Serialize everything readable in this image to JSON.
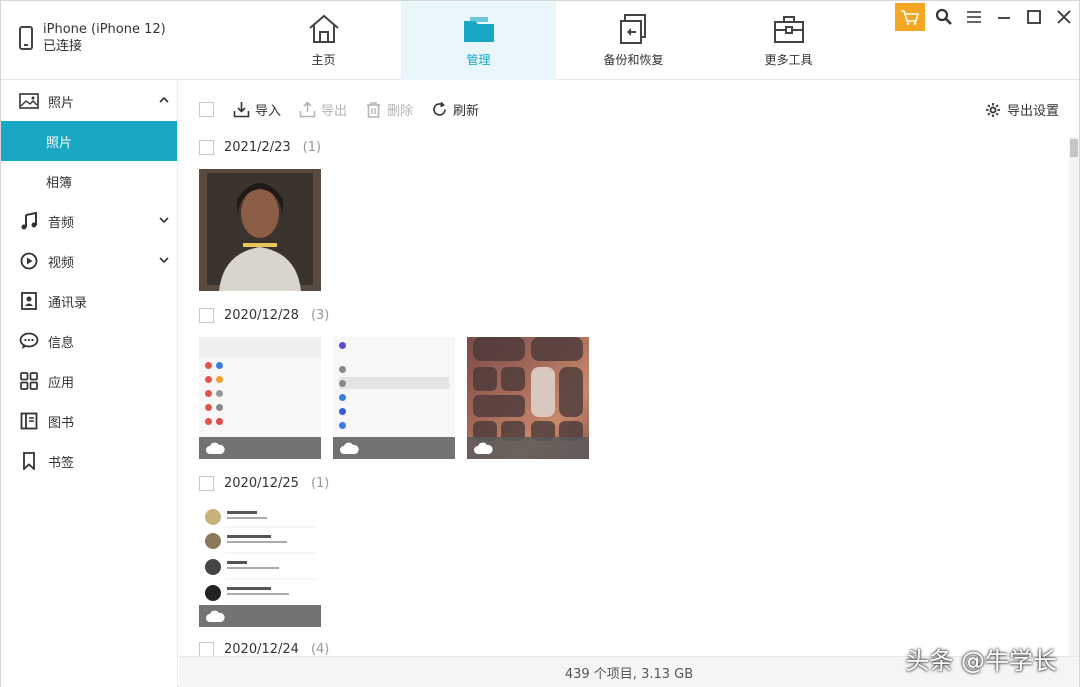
{
  "device": {
    "name": "iPhone (iPhone 12)",
    "status": "已连接"
  },
  "nav": {
    "tabs": [
      {
        "label": "主页",
        "icon": "home-icon"
      },
      {
        "label": "管理",
        "icon": "folder-icon",
        "active": true
      },
      {
        "label": "备份和恢复",
        "icon": "backup-restore-icon"
      },
      {
        "label": "更多工具",
        "icon": "toolbox-icon"
      }
    ]
  },
  "window": {
    "accent": "#19a7c6",
    "shop_color": "#f5a623"
  },
  "sidebar": {
    "items": [
      {
        "label": "照片",
        "icon": "image-icon",
        "expanded": true
      },
      {
        "label": "照片",
        "sub": true,
        "active": true
      },
      {
        "label": "相簿",
        "sub": true
      },
      {
        "label": "音频",
        "icon": "music-icon"
      },
      {
        "label": "视频",
        "icon": "play-icon"
      },
      {
        "label": "通讯录",
        "icon": "contact-icon"
      },
      {
        "label": "信息",
        "icon": "message-icon"
      },
      {
        "label": "应用",
        "icon": "apps-icon"
      },
      {
        "label": "图书",
        "icon": "book-icon"
      },
      {
        "label": "书签",
        "icon": "bookmark-icon"
      }
    ]
  },
  "toolbar": {
    "import_label": "导入",
    "export_label": "导出",
    "delete_label": "删除",
    "refresh_label": "刷新",
    "export_settings_label": "导出设置"
  },
  "groups": [
    {
      "date": "2021/2/23",
      "count": "(1)"
    },
    {
      "date": "2020/12/28",
      "count": "(3)"
    },
    {
      "date": "2020/12/25",
      "count": "(1)"
    },
    {
      "date": "2020/12/24",
      "count": "(4)"
    }
  ],
  "status": {
    "summary": "439 个项目, 3.13 GB"
  },
  "watermark": "头条 @牛学长"
}
